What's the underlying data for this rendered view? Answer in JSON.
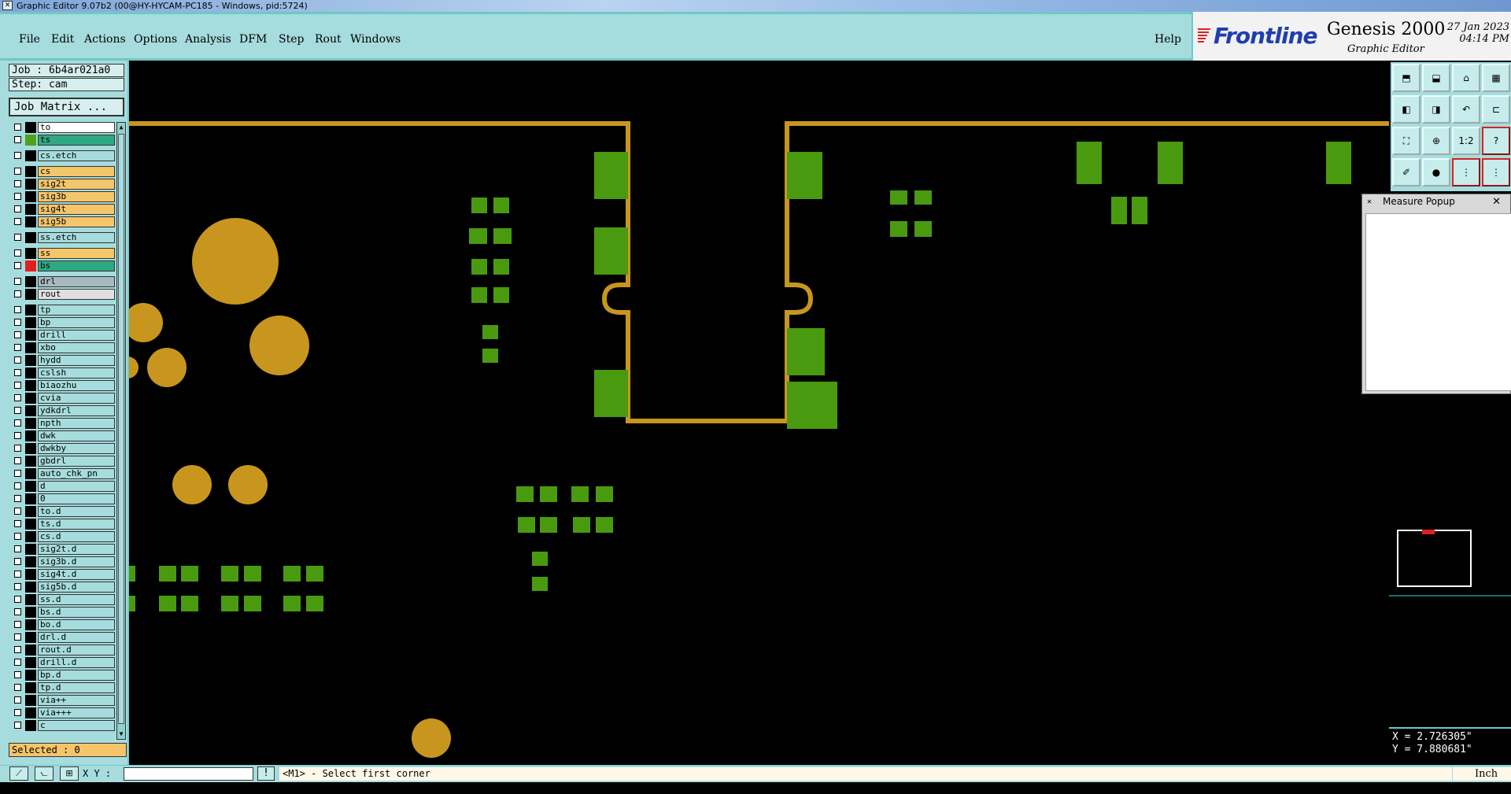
{
  "window": {
    "title": "Graphic Editor 9.07b2 (00@HY-HYCAM-PC185 - Windows, pid:5724)"
  },
  "menu": {
    "items": [
      "File",
      "Edit",
      "Actions",
      "Options",
      "Analysis",
      "DFM",
      "Step",
      "Rout",
      "Windows"
    ],
    "help": "Help"
  },
  "brand": {
    "logo": "Frontline",
    "product": "Genesis 2000",
    "subtitle": "Graphic Editor",
    "date": "27 Jan 2023",
    "time": "04:14 PM"
  },
  "job": {
    "job_label": "Job : 6b4ar021a0",
    "step_label": "Step: cam",
    "matrix_button": "Job Matrix ..."
  },
  "layers": [
    {
      "name": "to",
      "color": "#ffffff",
      "swatch": "#000000"
    },
    {
      "name": "ts",
      "color": "#2fa884",
      "swatch": "#4fa31a"
    },
    {
      "name": "cs.etch",
      "color": "#a6dcdd",
      "swatch": "#000000"
    },
    {
      "name": "cs",
      "color": "#f5c56a",
      "swatch": "#000000"
    },
    {
      "name": "sig2t",
      "color": "#f5c56a",
      "swatch": "#000000"
    },
    {
      "name": "sig3b",
      "color": "#f5c56a",
      "swatch": "#000000"
    },
    {
      "name": "sig4t",
      "color": "#f5c56a",
      "swatch": "#000000"
    },
    {
      "name": "sig5b",
      "color": "#f5c56a",
      "swatch": "#000000"
    },
    {
      "name": "ss.etch",
      "color": "#a6dcdd",
      "swatch": "#000000"
    },
    {
      "name": "ss",
      "color": "#f5c56a",
      "swatch": "#000000"
    },
    {
      "name": "bs",
      "color": "#2fa884",
      "swatch": "#e02020"
    },
    {
      "name": "drl",
      "color": "#a8b8c0",
      "swatch": "#000000"
    },
    {
      "name": "rout",
      "color": "#e0e0e0",
      "swatch": "#000000"
    },
    {
      "name": "tp",
      "color": "#a6dcdd",
      "swatch": "#000000"
    },
    {
      "name": "bp",
      "color": "#a6dcdd",
      "swatch": "#000000"
    },
    {
      "name": "drill",
      "color": "#a6dcdd",
      "swatch": "#000000"
    },
    {
      "name": "xbo",
      "color": "#a6dcdd",
      "swatch": "#000000"
    },
    {
      "name": "hydd",
      "color": "#a6dcdd",
      "swatch": "#000000"
    },
    {
      "name": "cslsh",
      "color": "#a6dcdd",
      "swatch": "#000000"
    },
    {
      "name": "biaozhu",
      "color": "#a6dcdd",
      "swatch": "#000000"
    },
    {
      "name": "cvia",
      "color": "#a6dcdd",
      "swatch": "#000000"
    },
    {
      "name": "ydkdrl",
      "color": "#a6dcdd",
      "swatch": "#000000"
    },
    {
      "name": "npth",
      "color": "#a6dcdd",
      "swatch": "#000000"
    },
    {
      "name": "dwk",
      "color": "#a6dcdd",
      "swatch": "#000000"
    },
    {
      "name": "dwkby",
      "color": "#a6dcdd",
      "swatch": "#000000"
    },
    {
      "name": "gbdrl",
      "color": "#a6dcdd",
      "swatch": "#000000"
    },
    {
      "name": "auto_chk_pn",
      "color": "#a6dcdd",
      "swatch": "#000000"
    },
    {
      "name": "d",
      "color": "#a6dcdd",
      "swatch": "#000000"
    },
    {
      "name": "0",
      "color": "#a6dcdd",
      "swatch": "#000000"
    },
    {
      "name": "to.d",
      "color": "#a6dcdd",
      "swatch": "#000000"
    },
    {
      "name": "ts.d",
      "color": "#a6dcdd",
      "swatch": "#000000"
    },
    {
      "name": "cs.d",
      "color": "#a6dcdd",
      "swatch": "#000000"
    },
    {
      "name": "sig2t.d",
      "color": "#a6dcdd",
      "swatch": "#000000"
    },
    {
      "name": "sig3b.d",
      "color": "#a6dcdd",
      "swatch": "#000000"
    },
    {
      "name": "sig4t.d",
      "color": "#a6dcdd",
      "swatch": "#000000"
    },
    {
      "name": "sig5b.d",
      "color": "#a6dcdd",
      "swatch": "#000000"
    },
    {
      "name": "ss.d",
      "color": "#a6dcdd",
      "swatch": "#000000"
    },
    {
      "name": "bs.d",
      "color": "#a6dcdd",
      "swatch": "#000000"
    },
    {
      "name": "bo.d",
      "color": "#a6dcdd",
      "swatch": "#000000"
    },
    {
      "name": "drl.d",
      "color": "#a6dcdd",
      "swatch": "#000000"
    },
    {
      "name": "rout.d",
      "color": "#a6dcdd",
      "swatch": "#000000"
    },
    {
      "name": "drill.d",
      "color": "#a6dcdd",
      "swatch": "#000000"
    },
    {
      "name": "bp.d",
      "color": "#a6dcdd",
      "swatch": "#000000"
    },
    {
      "name": "tp.d",
      "color": "#a6dcdd",
      "swatch": "#000000"
    },
    {
      "name": "via++",
      "color": "#a6dcdd",
      "swatch": "#000000"
    },
    {
      "name": "via+++",
      "color": "#a6dcdd",
      "swatch": "#000000"
    },
    {
      "name": "c",
      "color": "#a6dcdd",
      "swatch": "#000000"
    }
  ],
  "selected": "Selected : 0",
  "toolbar_icons": [
    "home-up-icon",
    "load-icon",
    "house-icon",
    "window-icon",
    "left-arrow-icon",
    "right-arrow-icon",
    "undo-icon",
    "split-icon",
    "fit-icon",
    "zoom-icon",
    "one-to-two-icon",
    "help-icon",
    "measure-icon",
    "pin-icon",
    "net-icon",
    "layers-icon"
  ],
  "toolbar_text": {
    "ratio": "1:2",
    "help": "?"
  },
  "measure_popup": {
    "title": "Measure Popup",
    "close": "✕"
  },
  "coords": {
    "x": "X = 2.726305\"",
    "y": "Y = 7.880681\""
  },
  "bottom": {
    "xy_label": "X Y :",
    "xy_value": "",
    "prompt_icon": "!",
    "prompt": "<M1> - Select first corner",
    "units": "Inch"
  },
  "colors": {
    "panel": "#a6dcdd",
    "trace": "#c8961e",
    "pad": "#4a9a10",
    "canvas": "#000000"
  }
}
